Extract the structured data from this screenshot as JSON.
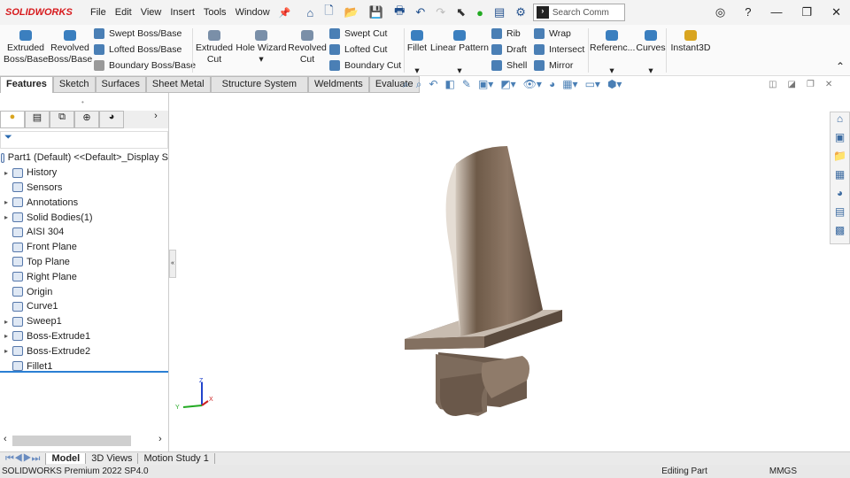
{
  "app": {
    "logo": "SOLIDWORKS",
    "search_placeholder": "Search Comm"
  },
  "menu": [
    "File",
    "Edit",
    "View",
    "Insert",
    "Tools",
    "Window"
  ],
  "ribbon": {
    "extruded_boss": "Extruded Boss/Base",
    "revolved_boss": "Revolved Boss/Base",
    "swept_boss": "Swept Boss/Base",
    "lofted_boss": "Lofted Boss/Base",
    "boundary_boss": "Boundary Boss/Base",
    "extruded_cut": "Extruded Cut",
    "hole_wizard": "Hole Wizard",
    "revolved_cut": "Revolved Cut",
    "swept_cut": "Swept Cut",
    "lofted_cut": "Lofted Cut",
    "boundary_cut": "Boundary Cut",
    "fillet": "Fillet",
    "linear_pattern": "Linear Pattern",
    "rib": "Rib",
    "draft": "Draft",
    "shell": "Shell",
    "wrap": "Wrap",
    "intersect": "Intersect",
    "mirror": "Mirror",
    "reference": "Referenc...",
    "curves": "Curves",
    "instant3d": "Instant3D"
  },
  "tabs": [
    "Features",
    "Sketch",
    "Surfaces",
    "Sheet Metal",
    "Structure System",
    "Weldments",
    "Evaluate"
  ],
  "tree": [
    {
      "label": "Part1 (Default) <<Default>_Display S",
      "arrow": ""
    },
    {
      "label": "History",
      "arrow": "▸"
    },
    {
      "label": "Sensors",
      "arrow": ""
    },
    {
      "label": "Annotations",
      "arrow": "▸"
    },
    {
      "label": "Solid Bodies(1)",
      "arrow": "▸"
    },
    {
      "label": "AISI 304",
      "arrow": ""
    },
    {
      "label": "Front Plane",
      "arrow": ""
    },
    {
      "label": "Top Plane",
      "arrow": ""
    },
    {
      "label": "Right Plane",
      "arrow": ""
    },
    {
      "label": "Origin",
      "arrow": ""
    },
    {
      "label": "Curve1",
      "arrow": ""
    },
    {
      "label": "Sweep1",
      "arrow": "▸"
    },
    {
      "label": "Boss-Extrude1",
      "arrow": "▸"
    },
    {
      "label": "Boss-Extrude2",
      "arrow": "▸"
    },
    {
      "label": "Fillet1",
      "arrow": ""
    }
  ],
  "bottom_tabs": [
    "Model",
    "3D Views",
    "Motion Study 1"
  ],
  "status": {
    "product": "SOLIDWORKS Premium 2022 SP4.0",
    "mode": "Editing Part",
    "units": "MMGS"
  },
  "triad": {
    "x": "X",
    "y": "Y",
    "z": "Z"
  }
}
